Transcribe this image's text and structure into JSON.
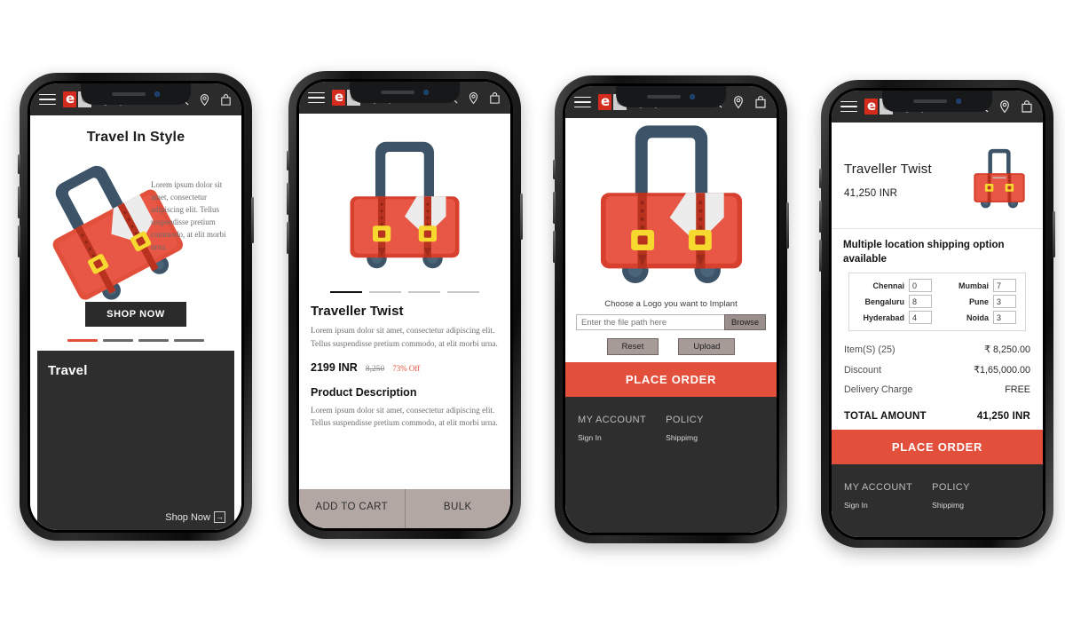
{
  "brand": {
    "logo_e": "e",
    "logo_c": "C",
    "logo_rest": "ompany",
    "accent_red": "#e2503c",
    "logo_red": "#d32b1e",
    "dark": "#2b2b2b"
  },
  "icons": {
    "menu": "hamburger-icon",
    "search": "search-icon",
    "location": "location-pin-icon",
    "bag": "shopping-bag-icon"
  },
  "screen1": {
    "title": "Travel In Style",
    "hero_text": "Lorem ipsum dolor sit amet, consectetur adipiscing elit. Tellus suspendisse pretium commodo, at elit morbi urna.",
    "shop_now": "SHOP NOW",
    "dots": 4,
    "active_dot": 0,
    "card_title": "Travel",
    "card_cta": "Shop Now",
    "card_cta_arrow": "→"
  },
  "screen2": {
    "thumbs": 4,
    "active_thumb": 0,
    "product_title": "Traveller Twist",
    "short_desc": "Lorem ipsum dolor sit amet, consectetur adipiscing elit. Tellus suspendisse pretium commodo, at elit morbi urna.",
    "price_now": "2199 INR",
    "price_old": "8,250",
    "price_off": "73% Off",
    "desc_heading": "Product Description",
    "long_desc": "Lorem ipsum dolor sit amet, consectetur adipiscing elit. Tellus suspendisse pretium commodo, at elit morbi urna.",
    "btn_add_to_cart": "ADD TO CART",
    "btn_bulk": "BULK"
  },
  "screen3": {
    "logo_label": "Choose a Logo you want to Implant",
    "file_placeholder": "Enter the file path here",
    "file_value": "",
    "btn_browse": "Browse",
    "btn_reset": "Reset",
    "btn_upload": "Upload",
    "btn_place_order": "PLACE ORDER",
    "footer": {
      "columns": [
        {
          "heading": "MY ACCOUNT",
          "links": [
            "Sign In"
          ]
        },
        {
          "heading": "POLICY",
          "links": [
            "Shippimg"
          ]
        }
      ]
    }
  },
  "screen4": {
    "product_title": "Traveller Twist",
    "product_price": "41,250 INR",
    "shipping_heading": "Multiple location shipping option available",
    "locations": [
      {
        "label": "Chennai",
        "value": "0"
      },
      {
        "label": "Mumbai",
        "value": "7"
      },
      {
        "label": "Bengaluru",
        "value": "8"
      },
      {
        "label": "Pune",
        "value": "3"
      },
      {
        "label": "Hyderabad",
        "value": "4"
      },
      {
        "label": "Noida",
        "value": "3"
      }
    ],
    "summary": [
      {
        "label": "Item(S) (25)",
        "value": "₹ 8,250.00"
      },
      {
        "label": "Discount",
        "value": "₹1,65,000.00"
      },
      {
        "label": "Delivery Charge",
        "value": "FREE"
      }
    ],
    "total_label": "TOTAL AMOUNT",
    "total_value": "41,250 INR",
    "btn_place_order": "PLACE ORDER",
    "footer": {
      "columns": [
        {
          "heading": "MY ACCOUNT",
          "links": [
            "Sign In"
          ]
        },
        {
          "heading": "POLICY",
          "links": [
            "Shippimg"
          ]
        }
      ]
    }
  }
}
